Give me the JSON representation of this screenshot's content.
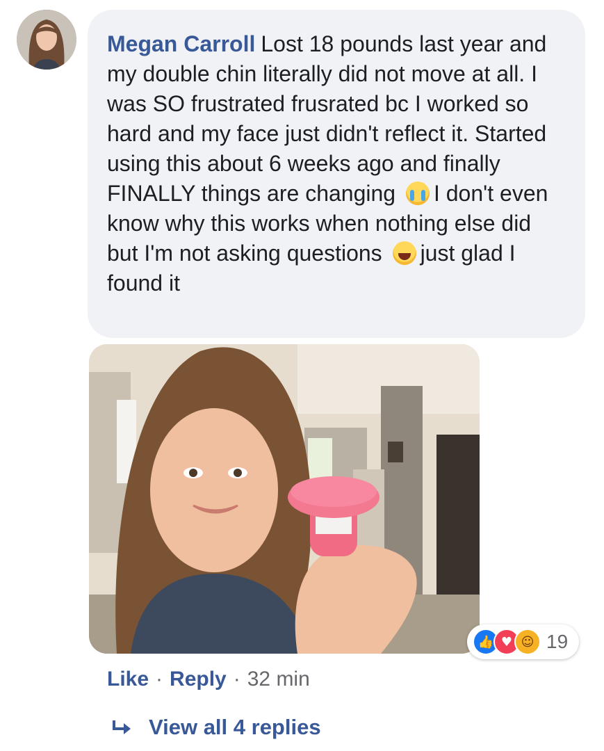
{
  "comment": {
    "author": "Megan Carroll",
    "text_part1": "Lost 18 pounds last year and my double chin literally did not move at all. I was SO frustrated frusrated bc I worked so hard and my face just didn't reflect it. Started using this about 6 weeks ago and finally FINALLY things are changing",
    "emoji1": "crying-face",
    "text_part2": "I don't even know why this works when nothing else did but I'm not asking questions",
    "emoji2": "laughing-face",
    "text_part3": "just glad I found it"
  },
  "reactions": {
    "types": [
      "like-icon",
      "love-icon",
      "haha-icon"
    ],
    "count": "19"
  },
  "actions": {
    "like": "Like",
    "separator": "·",
    "reply": "Reply",
    "time": "32 min"
  },
  "replies": {
    "label": "View all 4 replies"
  }
}
